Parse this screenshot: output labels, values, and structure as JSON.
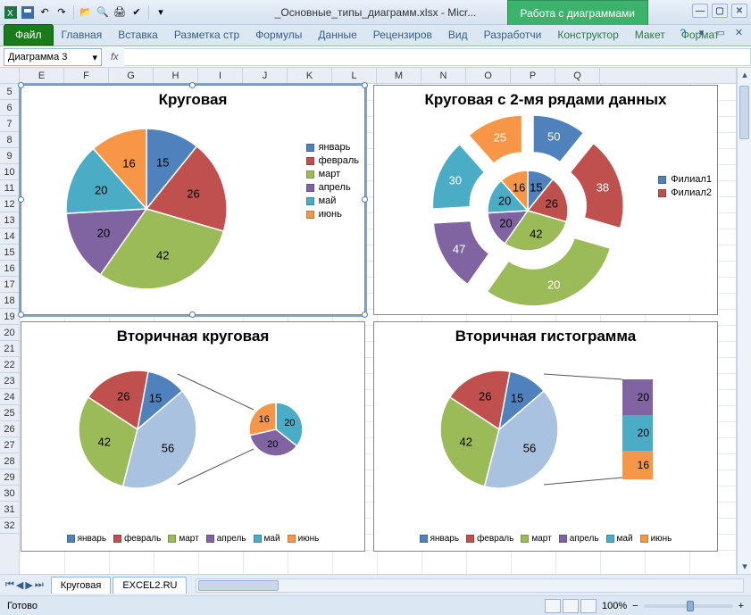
{
  "window": {
    "title": "_Основные_типы_диаграмм.xlsx - Micr...",
    "context_tab": "Работа с диаграммами"
  },
  "ribbon": {
    "file": "Файл",
    "tabs": [
      "Главная",
      "Вставка",
      "Разметка стр",
      "Формулы",
      "Данные",
      "Рецензиров",
      "Вид",
      "Разработчи"
    ],
    "ctx_tabs": [
      "Конструктор",
      "Макет",
      "Формат"
    ]
  },
  "namebox": {
    "value": "Диаграмма 3",
    "fx": "fx"
  },
  "columns": [
    "E",
    "F",
    "G",
    "H",
    "I",
    "J",
    "K",
    "L",
    "M",
    "N",
    "O",
    "P",
    "Q"
  ],
  "rows": [
    "5",
    "6",
    "7",
    "8",
    "9",
    "10",
    "11",
    "12",
    "13",
    "14",
    "15",
    "16",
    "17",
    "18",
    "19",
    "20",
    "21",
    "22",
    "23",
    "24",
    "25",
    "26",
    "27",
    "28",
    "29",
    "30",
    "31",
    "32"
  ],
  "status": {
    "ready": "Готово",
    "zoom": "100%",
    "minus": "−",
    "plus": "+"
  },
  "sheets": {
    "active": "Круговая",
    "second": "EXCEL2.RU"
  },
  "months": [
    "январь",
    "февраль",
    "март",
    "апрель",
    "май",
    "июнь"
  ],
  "branches": [
    "Филиал1",
    "Филиал2"
  ],
  "colors": {
    "jan": "#4f81bd",
    "feb": "#c0504d",
    "mar": "#9bbb59",
    "apr": "#8064a2",
    "may": "#4bacc6",
    "jun": "#f79646"
  },
  "chart_data": [
    {
      "id": "chart1",
      "type": "pie",
      "title": "Круговая",
      "categories": [
        "январь",
        "февраль",
        "март",
        "апрель",
        "май",
        "июнь"
      ],
      "values": [
        15,
        26,
        42,
        20,
        20,
        16
      ],
      "data_labels": [
        15,
        26,
        42,
        20,
        20,
        16
      ],
      "legend_position": "right"
    },
    {
      "id": "chart2",
      "type": "pie",
      "title": "Круговая с 2-мя рядами данных",
      "categories": [
        "январь",
        "февраль",
        "март",
        "апрель",
        "май",
        "июнь"
      ],
      "series": [
        {
          "name": "Филиал1",
          "values": [
            15,
            26,
            42,
            20,
            20,
            16
          ]
        },
        {
          "name": "Филиал2",
          "values": [
            50,
            38,
            20,
            47,
            30,
            25
          ]
        }
      ],
      "legend_position": "right"
    },
    {
      "id": "chart3",
      "type": "pie",
      "subtype": "pie-of-pie",
      "title": "Вторичная круговая",
      "categories": [
        "январь",
        "февраль",
        "март",
        "апрель",
        "май",
        "июнь"
      ],
      "values": [
        15,
        26,
        42,
        56,
        20,
        16
      ],
      "secondary_slot": [
        20,
        20,
        16
      ],
      "primary_labels": [
        42,
        26,
        15,
        56
      ],
      "legend_position": "bottom"
    },
    {
      "id": "chart4",
      "type": "pie",
      "subtype": "bar-of-pie",
      "title": "Вторичная гистограмма",
      "categories": [
        "январь",
        "февраль",
        "март",
        "апрель",
        "май",
        "июнь"
      ],
      "values": [
        15,
        26,
        42,
        56,
        20,
        16
      ],
      "secondary_slot": [
        20,
        20,
        16
      ],
      "primary_labels": [
        42,
        26,
        15,
        56
      ],
      "legend_position": "bottom"
    }
  ]
}
